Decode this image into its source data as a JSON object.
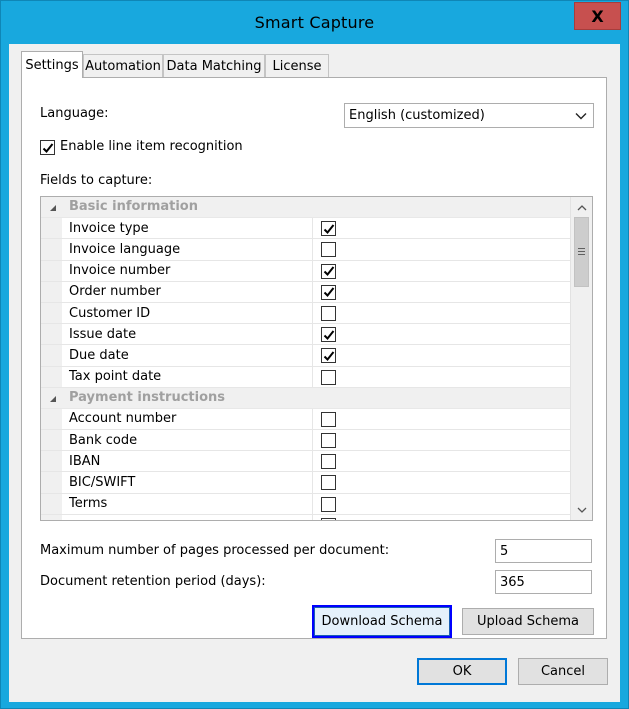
{
  "window": {
    "title": "Smart Capture",
    "close_glyph": "X"
  },
  "tabs": [
    {
      "label": "Settings",
      "active": true
    },
    {
      "label": "Automation",
      "active": false
    },
    {
      "label": "Data Matching",
      "active": false
    },
    {
      "label": "License",
      "active": false
    }
  ],
  "settings": {
    "language_label": "Language:",
    "language_value": "English (customized)",
    "line_item_label": "Enable line item recognition",
    "line_item_checked": true,
    "fields_label": "Fields to capture:",
    "max_pages_label": "Maximum number of pages processed per document:",
    "max_pages_value": "5",
    "retention_label": "Document retention period (days):",
    "retention_value": "365",
    "download_schema_label": "Download Schema",
    "upload_schema_label": "Upload Schema"
  },
  "fields": [
    {
      "type": "category",
      "label": "Basic information"
    },
    {
      "type": "item",
      "label": "Invoice type",
      "checked": true
    },
    {
      "type": "item",
      "label": "Invoice language",
      "checked": false
    },
    {
      "type": "item",
      "label": "Invoice number",
      "checked": true
    },
    {
      "type": "item",
      "label": "Order number",
      "checked": true
    },
    {
      "type": "item",
      "label": "Customer ID",
      "checked": false
    },
    {
      "type": "item",
      "label": "Issue date",
      "checked": true
    },
    {
      "type": "item",
      "label": "Due date",
      "checked": true
    },
    {
      "type": "item",
      "label": "Tax point date",
      "checked": false
    },
    {
      "type": "category",
      "label": "Payment instructions"
    },
    {
      "type": "item",
      "label": "Account number",
      "checked": false
    },
    {
      "type": "item",
      "label": "Bank code",
      "checked": false
    },
    {
      "type": "item",
      "label": "IBAN",
      "checked": false
    },
    {
      "type": "item",
      "label": "BIC/SWIFT",
      "checked": false
    },
    {
      "type": "item",
      "label": "Terms",
      "checked": false
    },
    {
      "type": "item",
      "label": "",
      "checked": false
    }
  ],
  "footer": {
    "ok_label": "OK",
    "cancel_label": "Cancel"
  },
  "colors": {
    "titlebar": "#18a8de",
    "close_button": "#c7504f",
    "focus_border": "#0000ff"
  }
}
